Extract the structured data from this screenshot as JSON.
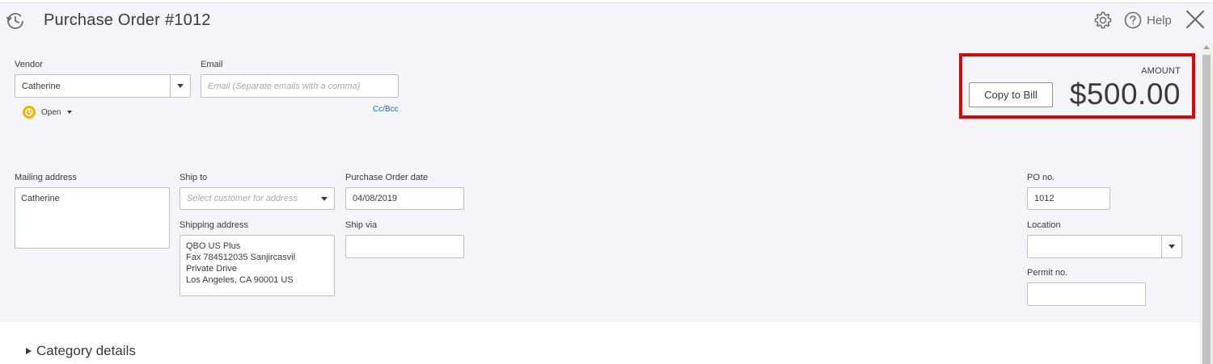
{
  "header": {
    "title": "Purchase Order",
    "number": "#1012",
    "help_label": "Help"
  },
  "vendor": {
    "label": "Vendor",
    "value": "Catherine"
  },
  "email": {
    "label": "Email",
    "placeholder": "Email (Separate emails with a comma)",
    "ccbcc": "Cc/Bcc"
  },
  "status": {
    "label": "Open"
  },
  "amount": {
    "label": "AMOUNT",
    "value": "$500.00",
    "copy_button": "Copy to Bill"
  },
  "mailing_address": {
    "label": "Mailing address",
    "lines": [
      "Catherine"
    ]
  },
  "ship_to": {
    "label": "Ship to",
    "placeholder": "Select customer for address"
  },
  "shipping_address": {
    "label": "Shipping address",
    "lines": [
      "QBO US Plus",
      "Fax 784512035 Sanjircasvil",
      "Private Drive",
      "Los Angeles, CA  90001 US"
    ]
  },
  "po_date": {
    "label": "Purchase Order date",
    "value": "04/08/2019"
  },
  "ship_via": {
    "label": "Ship via",
    "value": ""
  },
  "po_no": {
    "label": "PO no.",
    "value": "1012"
  },
  "location": {
    "label": "Location",
    "value": ""
  },
  "permit_no": {
    "label": "Permit no.",
    "value": ""
  },
  "category_details": {
    "label": "Category details"
  },
  "colors": {
    "accent_link": "#0077c5",
    "highlight": "#e00000",
    "status_open": "#f2b200"
  }
}
